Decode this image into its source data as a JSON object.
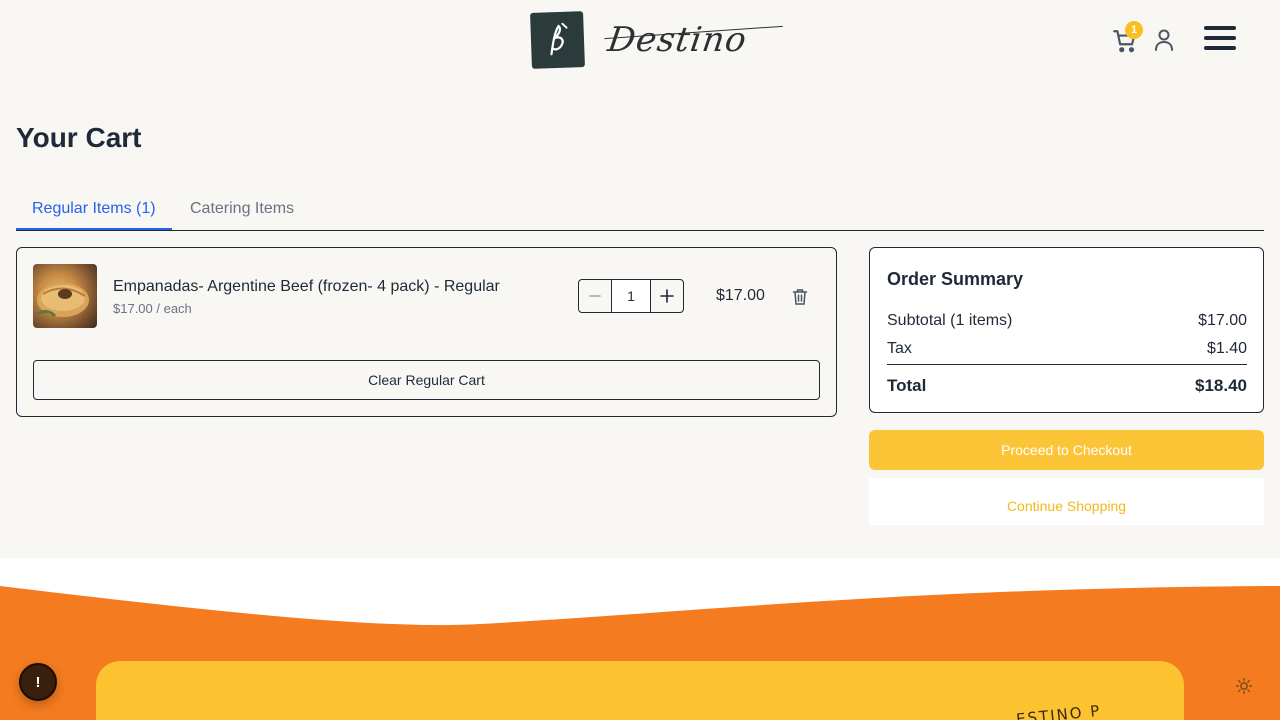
{
  "brand": {
    "name": "Destino",
    "accent": "#fcc538",
    "orange": "#f47b20"
  },
  "header": {
    "cart_count": "1",
    "icons": [
      "cart-icon",
      "user-icon",
      "menu-icon"
    ]
  },
  "page": {
    "title": "Your Cart"
  },
  "tabs": [
    {
      "label": "Regular Items (1)",
      "active": true
    },
    {
      "label": "Catering Items",
      "active": false
    }
  ],
  "cart": {
    "items": [
      {
        "name": "Empanadas- Argentine Beef (frozen- 4 pack) - Regular",
        "unit_price": "$17.00 / each",
        "quantity": "1",
        "line_total": "$17.00"
      }
    ],
    "clear_label": "Clear Regular Cart"
  },
  "summary": {
    "title": "Order Summary",
    "subtotal_label": "Subtotal (1 items)",
    "subtotal_value": "$17.00",
    "tax_label": "Tax",
    "tax_value": "$1.40",
    "total_label": "Total",
    "total_value": "$18.40"
  },
  "actions": {
    "checkout_label": "Proceed to Checkout",
    "continue_label": "Continue Shopping"
  },
  "footer": {
    "stamp_text": "ESTINO P",
    "alert_label": "!"
  }
}
